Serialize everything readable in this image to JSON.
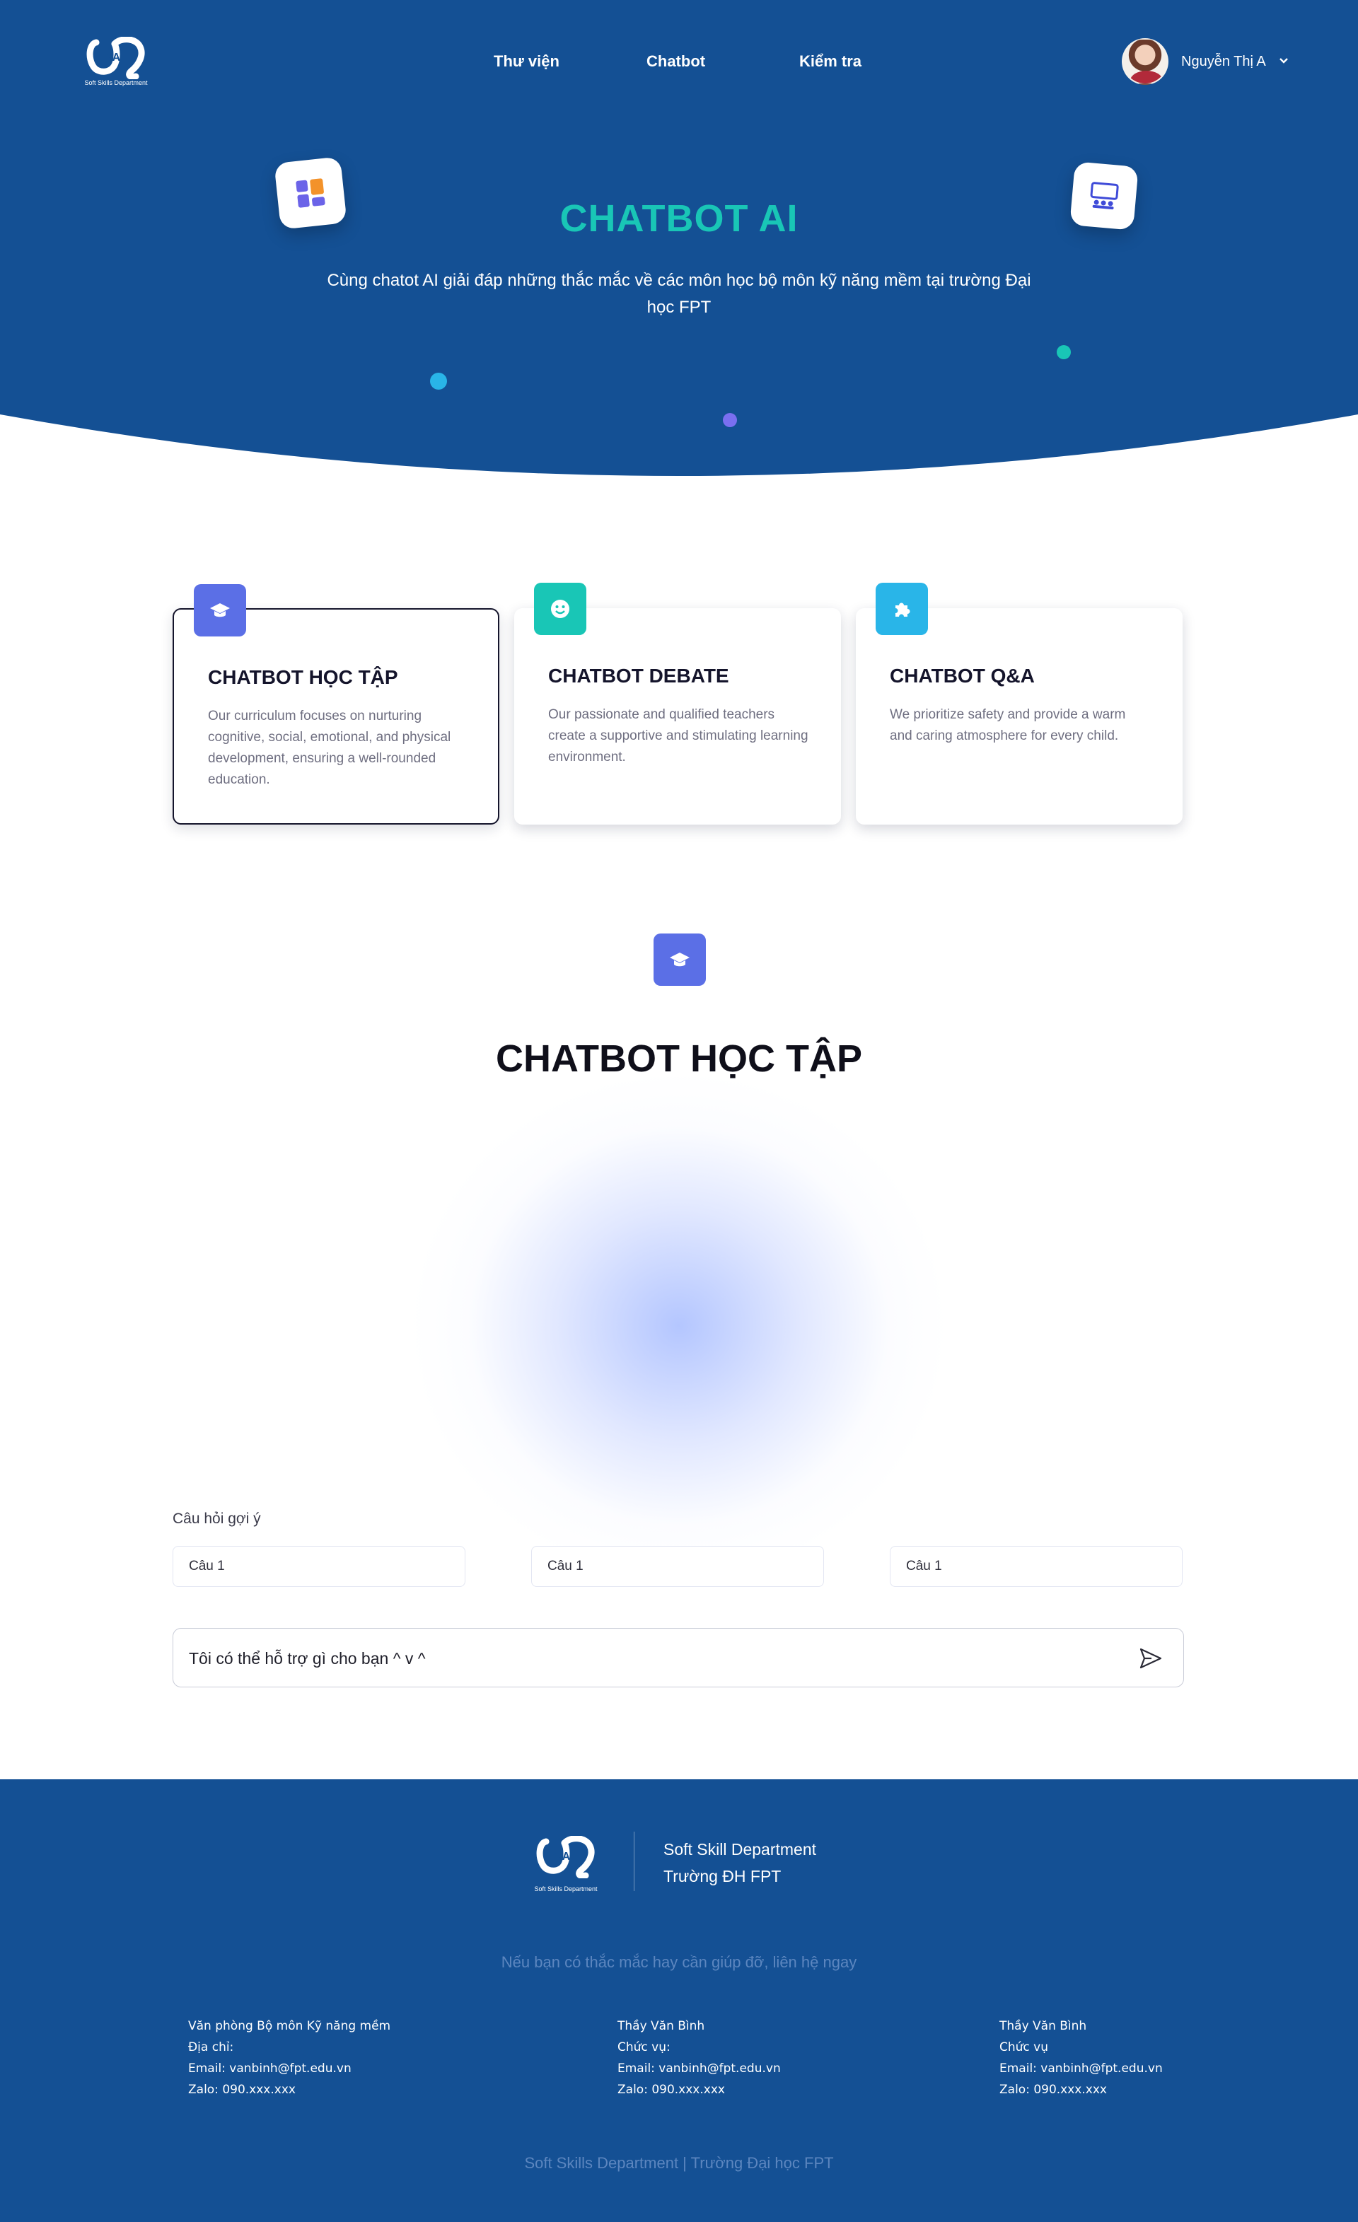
{
  "brand": {
    "logo_caption": "Soft Skills Department"
  },
  "nav": {
    "links": [
      "Thư viện",
      "Chatbot",
      "Kiểm tra"
    ],
    "user_name": "Nguyễn Thị A"
  },
  "hero": {
    "title": "CHATBOT AI",
    "subtitle": "Cùng chatot AI giải đáp những thắc mắc về các môn học bộ môn kỹ năng mềm tại trường Đại học FPT"
  },
  "features": [
    {
      "title": "CHATBOT HỌC TẬP",
      "description": "Our curriculum focuses on nurturing cognitive, social, emotional, and physical development, ensuring a well-rounded education.",
      "icon": "graduation-cap-icon",
      "color": "#5b6fe6"
    },
    {
      "title": "CHATBOT DEBATE",
      "description": "Our passionate and qualified teachers create a supportive and stimulating learning environment.",
      "icon": "smiley-icon",
      "color": "#19c6b6"
    },
    {
      "title": "CHATBOT Q&A",
      "description": "We prioritize safety and provide a warm and caring atmosphere for every child.",
      "icon": "puzzle-icon",
      "color": "#29b5e8"
    }
  ],
  "chat": {
    "title": "CHATBOT HỌC TẬP",
    "suggest_label": "Câu hỏi gợi ý",
    "suggestions": [
      "Câu 1",
      "Câu 1",
      "Câu 1"
    ],
    "input_placeholder": "Tôi có thể hỗ trợ gì cho bạn ^ v ^"
  },
  "footer": {
    "org_name": "Soft Skill Department",
    "org_school": "Trường ĐH FPT",
    "help_text": "Nếu bạn có thắc mắc hay cần giúp đỡ, liên hệ ngay",
    "contacts": [
      [
        "Văn phòng Bộ môn Kỹ năng mềm",
        "Địa chỉ:",
        "Email: vanbinh@fpt.edu.vn",
        "Zalo: 090.xxx.xxx"
      ],
      [
        "Thầy Văn Bình",
        "Chức vụ:",
        "Email: vanbinh@fpt.edu.vn",
        "Zalo: 090.xxx.xxx"
      ],
      [
        "Thầy Văn Bình",
        "Chức vụ",
        "Email: vanbinh@fpt.edu.vn",
        "Zalo: 090.xxx.xxx"
      ]
    ],
    "copyright": "Soft Skills Department | Trường Đại học FPT"
  },
  "colors": {
    "primary": "#145094",
    "accent_teal": "#19c6b6",
    "dot_cyan": "#29b5e8",
    "dot_purple": "#7a6ff0"
  }
}
